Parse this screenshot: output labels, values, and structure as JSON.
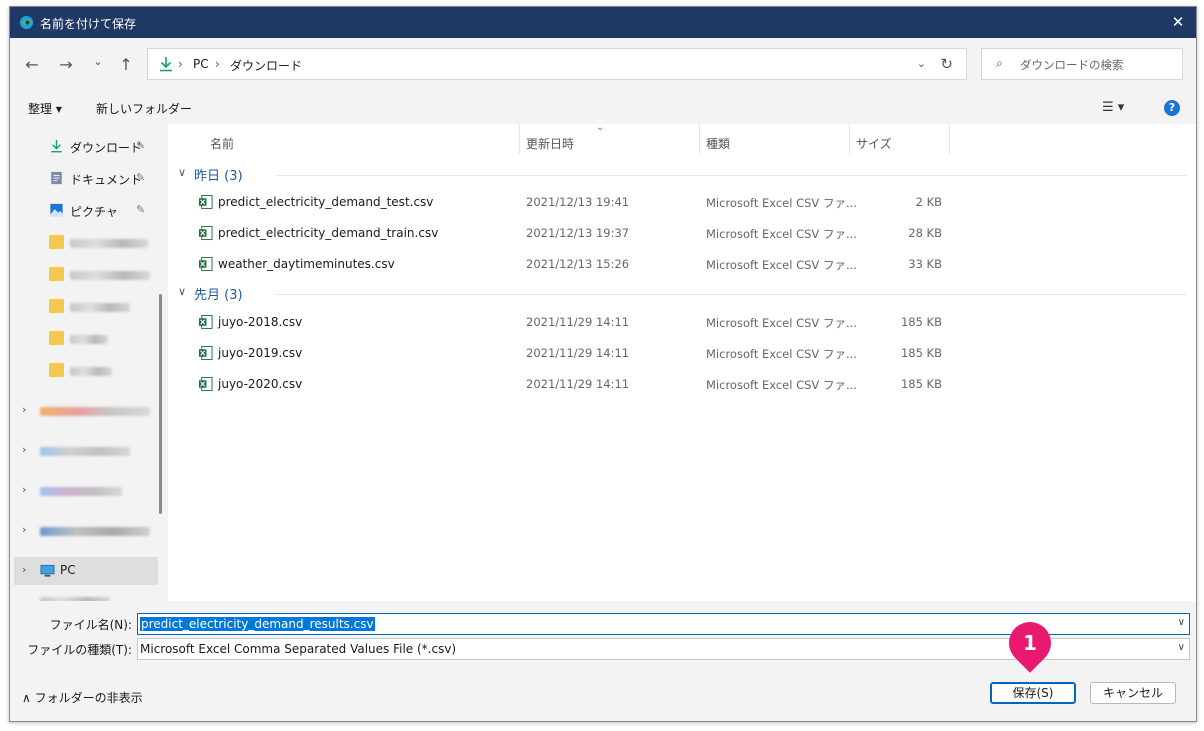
{
  "window": {
    "title": "名前を付けて保存",
    "close": "✕"
  },
  "nav": {
    "back": "←",
    "forward": "→",
    "recent": "⌄",
    "up": "↑",
    "breadcrumb": [
      "PC",
      "ダウンロード"
    ],
    "separator": "›",
    "search_placeholder": "ダウンロードの検索"
  },
  "toolbar": {
    "organize": "整理 ▾",
    "new_folder": "新しいフォルダー",
    "view": "☰ ▾",
    "help": "?"
  },
  "sidebar": {
    "items": [
      {
        "label": "ダウンロード",
        "icon": "download-icon",
        "pinned": true
      },
      {
        "label": "ドキュメント",
        "icon": "document-icon",
        "pinned": true
      },
      {
        "label": "ピクチャ",
        "icon": "picture-icon",
        "pinned": true
      }
    ],
    "pc_label": "PC",
    "pin": "📌",
    "chevron": "›"
  },
  "columns": {
    "name": "名前",
    "date": "更新日時",
    "type": "種類",
    "size": "サイズ"
  },
  "groups": [
    {
      "label": "昨日 (3)",
      "files": [
        {
          "name": "predict_electricity_demand_test.csv",
          "date": "2021/12/13 19:41",
          "type": "Microsoft Excel CSV ファ...",
          "size": "2 KB"
        },
        {
          "name": "predict_electricity_demand_train.csv",
          "date": "2021/12/13 19:37",
          "type": "Microsoft Excel CSV ファ...",
          "size": "28 KB"
        },
        {
          "name": "weather_daytimeminutes.csv",
          "date": "2021/12/13 15:26",
          "type": "Microsoft Excel CSV ファ...",
          "size": "33 KB"
        }
      ]
    },
    {
      "label": "先月 (3)",
      "files": [
        {
          "name": "juyo-2018.csv",
          "date": "2021/11/29 14:11",
          "type": "Microsoft Excel CSV ファ...",
          "size": "185 KB"
        },
        {
          "name": "juyo-2019.csv",
          "date": "2021/11/29 14:11",
          "type": "Microsoft Excel CSV ファ...",
          "size": "185 KB"
        },
        {
          "name": "juyo-2020.csv",
          "date": "2021/11/29 14:11",
          "type": "Microsoft Excel CSV ファ...",
          "size": "185 KB"
        }
      ]
    }
  ],
  "footer": {
    "filename_label": "ファイル名(N):",
    "filename_value": "predict_electricity_demand_results.csv",
    "filetype_label": "ファイルの種類(T):",
    "filetype_value": "Microsoft Excel Comma Separated Values File (*.csv)",
    "hide_folders": "フォルダーの非表示",
    "save": "保存(S)",
    "cancel": "キャンセル"
  },
  "annotation": {
    "number": "1",
    "color": "#e8196f"
  },
  "colors": {
    "titlebar": "#1f3864",
    "accent": "#0067c0",
    "excel_green": "#1d6f42",
    "folder": "#f2c94c"
  }
}
